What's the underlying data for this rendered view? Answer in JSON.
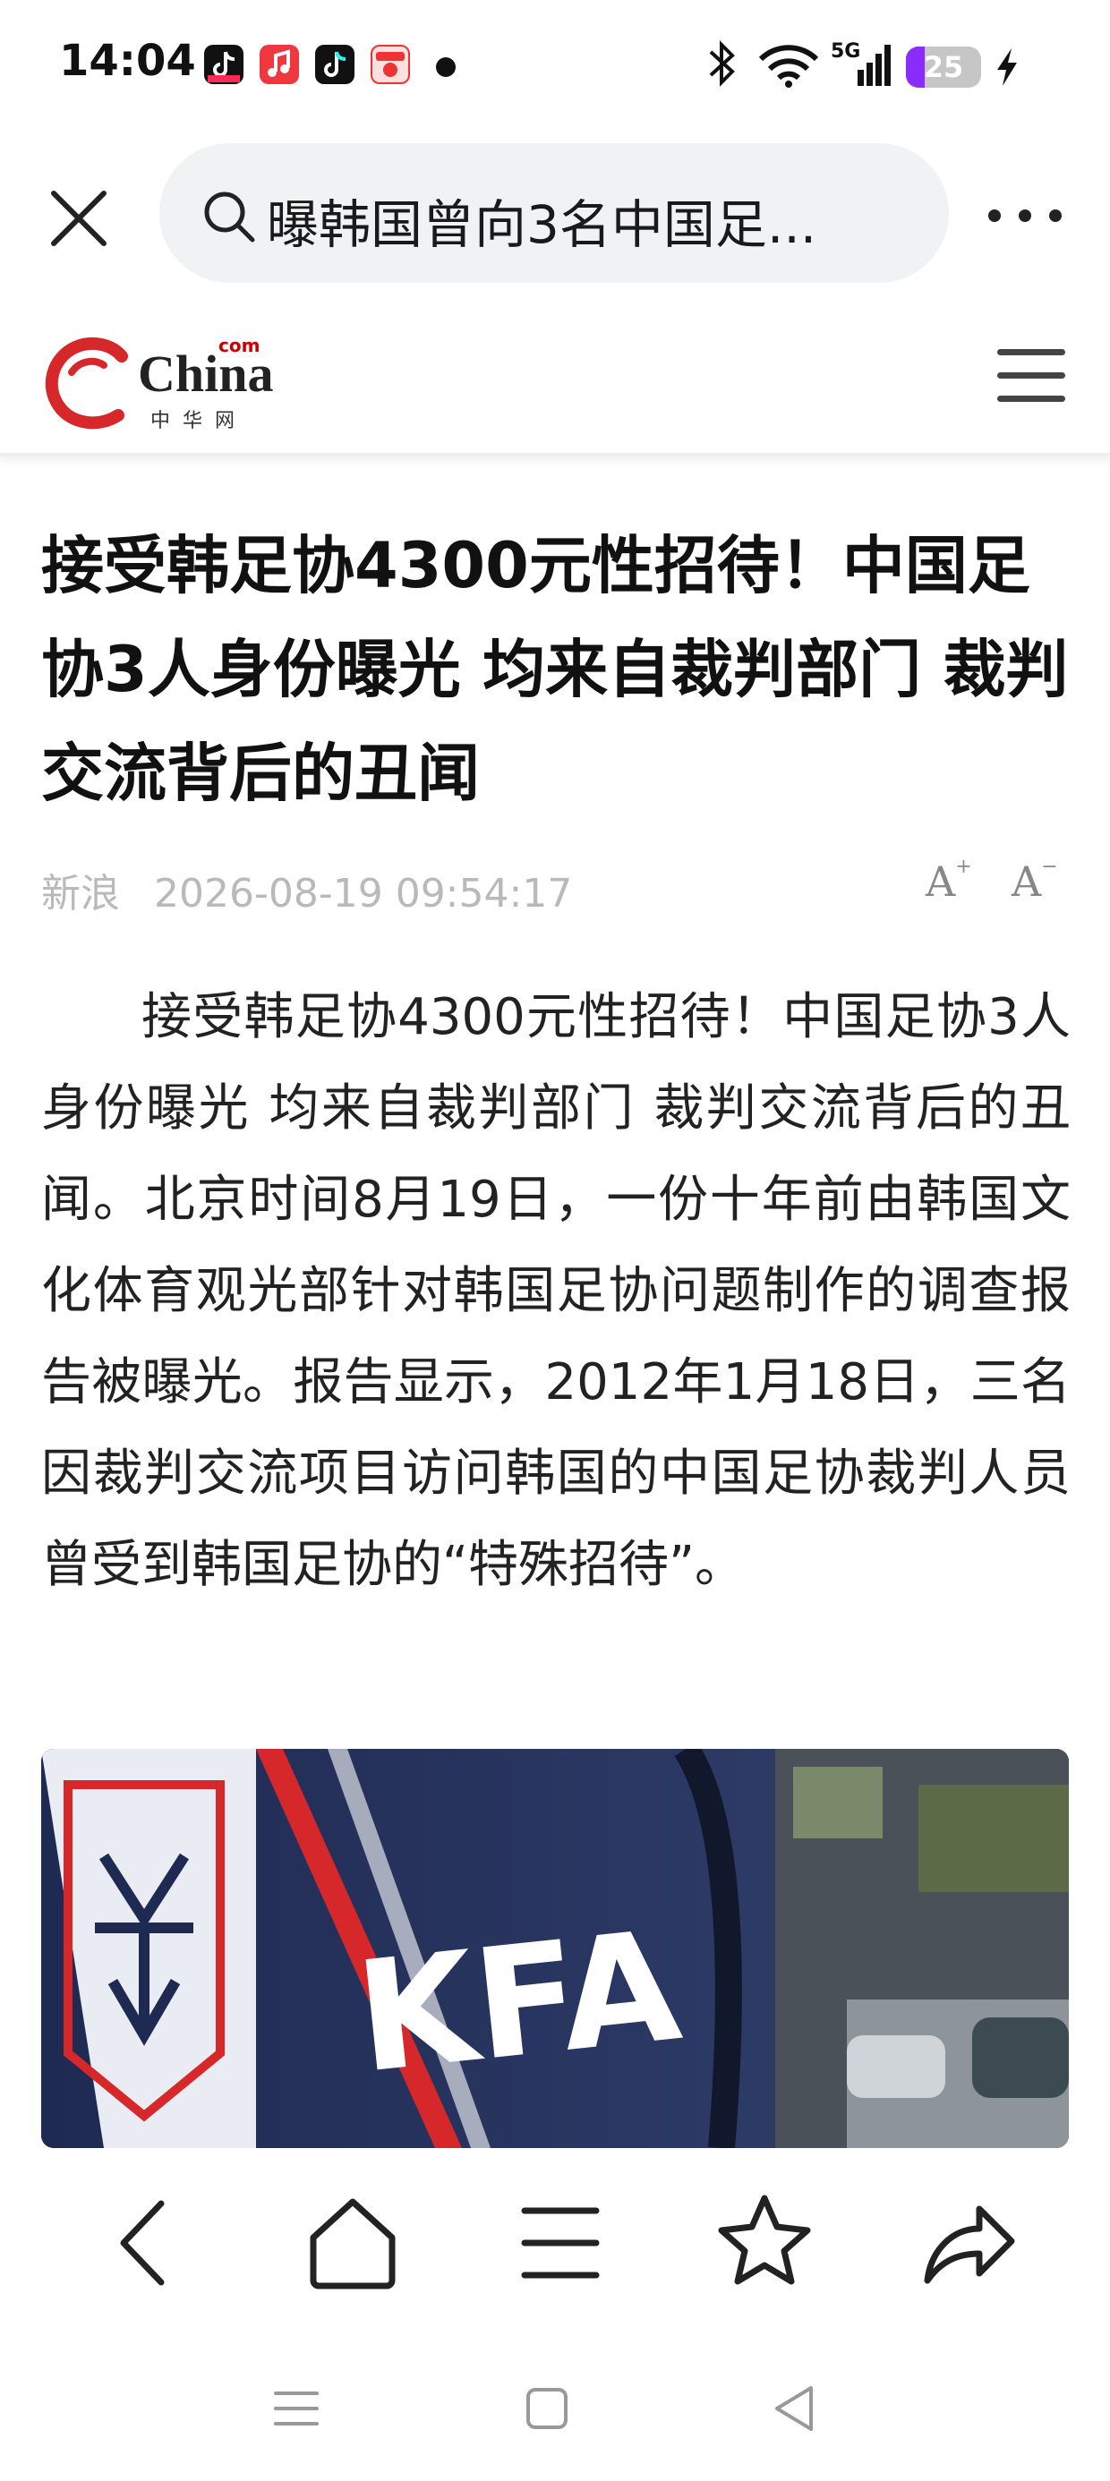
{
  "status_bar": {
    "time": "14:04",
    "network": "5G",
    "battery": 25,
    "icons": [
      "tiktok-lite-icon",
      "music-app-icon",
      "tiktok-icon",
      "shopping-app-icon",
      "notification-dot-icon",
      "bluetooth-icon",
      "wifi-icon",
      "signal-icon",
      "battery-icon",
      "charging-icon"
    ]
  },
  "search_bar": {
    "query": "曝韩国曾向3名中国足..."
  },
  "site": {
    "logo_main": "China",
    "logo_com": "com",
    "logo_sub": "中华网"
  },
  "article": {
    "title": "接受韩足协4300元性招待！中国足协3人身份曝光 均来自裁判部门 裁判交流背后的丑闻",
    "source": "新浪",
    "datetime": "2026-08-19 09:54:17",
    "font_increase": "A",
    "font_decrease": "A",
    "body": "接受韩足协4300元性招待！中国足协3人身份曝光 均来自裁判部门 裁判交流背后的丑闻。北京时间8月19日，一份十年前由韩国文化体育观光部针对韩国足协问题制作的调查报告被曝光。报告显示，2012年1月18日，三名因裁判交流项目访问韩国的中国足协裁判人员曾受到韩国足协的“特殊招待”。",
    "image_text": "KFA"
  },
  "colors": {
    "brand_red": "#d6282b",
    "battery_purple": "#8a2bff",
    "meta_gray": "#b9b9b9"
  }
}
